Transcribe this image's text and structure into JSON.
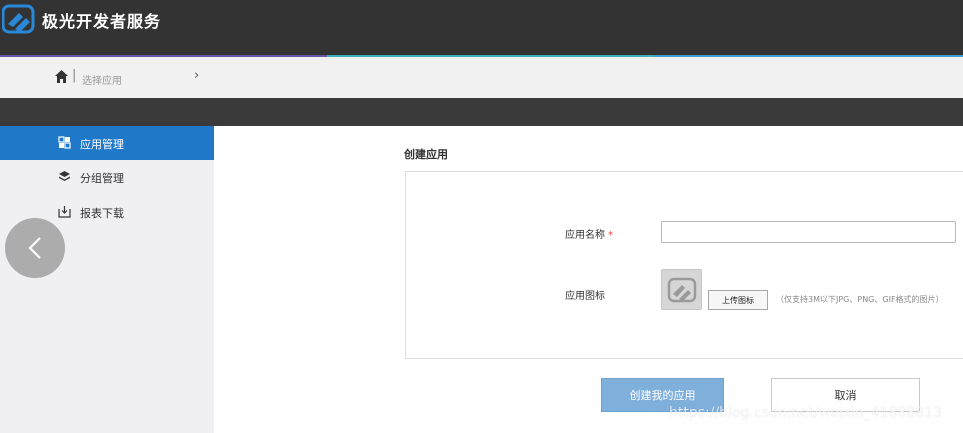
{
  "header": {
    "brand_title": "极光开发者服务",
    "logo_icon": "jiguang-logo-icon",
    "accent_colors": [
      "#6a56a8",
      "#3bb0b8",
      "#3aa0cc"
    ]
  },
  "breadcrumb": {
    "home_icon": "home-icon",
    "separator": "|",
    "current": "选择应用",
    "chevron": "›"
  },
  "sidebar": {
    "items": [
      {
        "label": "应用管理",
        "icon": "app-grid-icon",
        "active": true
      },
      {
        "label": "分组管理",
        "icon": "layers-icon",
        "active": false
      },
      {
        "label": "报表下载",
        "icon": "download-icon",
        "active": false
      }
    ],
    "active_color": "#1f78c8"
  },
  "main": {
    "title": "创建应用",
    "form": {
      "app_name_label": "应用名称",
      "required_mark": "*",
      "app_name_value": "",
      "app_icon_label": "应用图标",
      "upload_button": "上传图标",
      "upload_hint": "（仅支持3M以下JPG、PNG、GIF格式的图片）"
    },
    "create_button": "创建我的应用",
    "cancel_button": "取消"
  },
  "overlay": {
    "back_icon": "chevron-left-icon",
    "watermark": "https://blog.csdn.net/weixin_41888813"
  }
}
